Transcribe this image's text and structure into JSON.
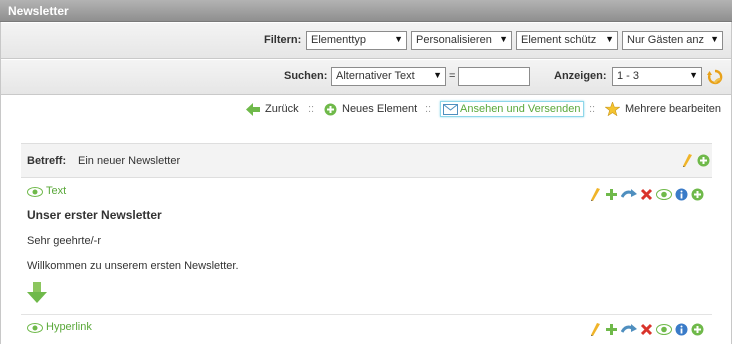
{
  "window": {
    "title": "Newsletter"
  },
  "filter": {
    "label": "Filtern:",
    "selects": [
      {
        "value": "Elementtyp"
      },
      {
        "value": "Personalisieren"
      },
      {
        "value": "Element schütz"
      },
      {
        "value": "Nur Gästen anz"
      }
    ]
  },
  "search": {
    "label": "Suchen:",
    "field_select": "Alternativer Text",
    "equals": "=",
    "value": "",
    "show_label": "Anzeigen:",
    "show_value": "1 - 3"
  },
  "nav": {
    "back": "Zurück",
    "new_element": "Neues Element",
    "view_send": "Ansehen und Versenden",
    "edit_multiple": "Mehrere bearbeiten",
    "separator": "::"
  },
  "subject": {
    "label": "Betreff:",
    "value": "Ein neuer Newsletter"
  },
  "elements": [
    {
      "type_label": "Text",
      "heading": "Unser erster Newsletter",
      "paragraphs": [
        "Sehr geehrte/-r",
        "Willkommen zu unserem ersten Newsletter."
      ]
    },
    {
      "type_label": "Hyperlink"
    }
  ],
  "colors": {
    "accent_green": "#5aa83a",
    "titlebar": "#9d9d9d",
    "focus_blue": "#8fd7ea"
  },
  "icons": [
    "refresh-icon",
    "back-arrow-icon",
    "add-circle-icon",
    "envelope-icon",
    "star-icon",
    "pencil-icon",
    "plus-icon",
    "move-icon",
    "delete-icon",
    "eye-icon",
    "info-icon",
    "down-arrow-icon"
  ]
}
